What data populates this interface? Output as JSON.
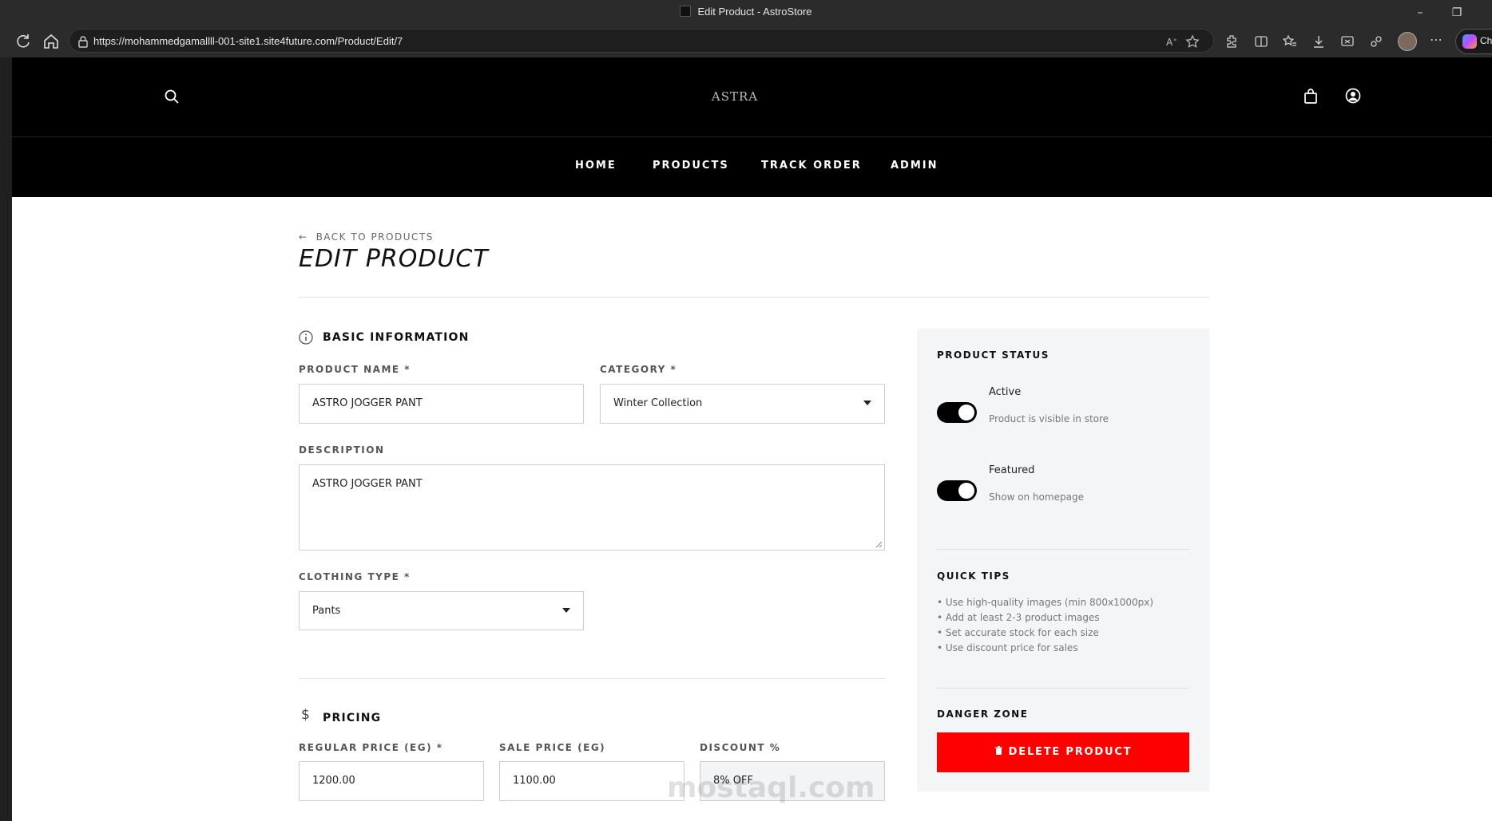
{
  "browser": {
    "tab_title": "Edit Product - AstroStore",
    "url": "https://mohammedgamallll-001-site1.site4future.com/Product/Edit/7",
    "copilot_label": "Ch"
  },
  "site": {
    "logo_text": "ASTRA",
    "nav": [
      "HOME",
      "PRODUCTS",
      "TRACK ORDER",
      "ADMIN"
    ]
  },
  "page": {
    "back_link": "BACK TO PRODUCTS",
    "title": "EDIT PRODUCT"
  },
  "basic_info": {
    "section_title": "BASIC INFORMATION",
    "product_name_label": "PRODUCT NAME *",
    "product_name_value": "ASTRO JOGGER PANT",
    "category_label": "CATEGORY *",
    "category_value": "Winter Collection",
    "description_label": "DESCRIPTION",
    "description_value": "ASTRO JOGGER PANT",
    "clothing_type_label": "CLOTHING TYPE *",
    "clothing_type_value": "Pants"
  },
  "pricing": {
    "section_title": "PRICING",
    "regular_label": "REGULAR PRICE (EG) *",
    "regular_value": "1200.00",
    "sale_label": "SALE PRICE (EG)",
    "sale_value": "1100.00",
    "discount_label": "DISCOUNT %",
    "discount_value": "8% OFF"
  },
  "status": {
    "title": "PRODUCT STATUS",
    "active_label": "Active",
    "active_desc": "Product is visible in store",
    "active_on": true,
    "featured_label": "Featured",
    "featured_desc": "Show on homepage",
    "featured_on": true
  },
  "tips": {
    "title": "QUICK TIPS",
    "items": [
      "• Use high-quality images (min 800x1000px)",
      "• Add at least 2-3 product images",
      "• Set accurate stock for each size",
      "• Use discount price for sales"
    ]
  },
  "danger": {
    "title": "DANGER ZONE",
    "delete_label": "DELETE PRODUCT"
  },
  "watermark": "mostaql.com",
  "colors": {
    "header_bg": "#000000",
    "danger": "#ff0000",
    "panel_bg": "#f4f5f7"
  }
}
